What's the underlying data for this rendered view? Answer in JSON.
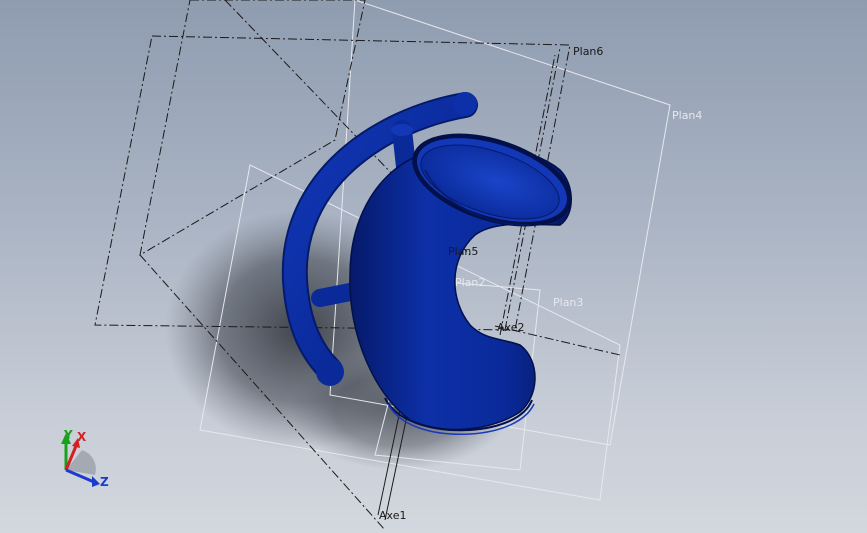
{
  "viewport": {
    "name": "3d-model-viewport"
  },
  "planes": {
    "plan6": "Plan6",
    "plan4": "Plan4",
    "plan5": "Plan5",
    "plan3": "Plan3",
    "plan2": "Plan2"
  },
  "axes": {
    "axe1": "Axe1",
    "axe2": "Axe2"
  },
  "triad": {
    "y": "Y",
    "x": "X",
    "z": "Z"
  },
  "colors": {
    "model": "#0a2a9a",
    "model_dark": "#061a6a",
    "plane_dark": "#1a1a1a",
    "plane_light": "#e6e8ee",
    "triad_y": "#1aa01a",
    "triad_x": "#d42020",
    "triad_z": "#1a3ad0"
  }
}
